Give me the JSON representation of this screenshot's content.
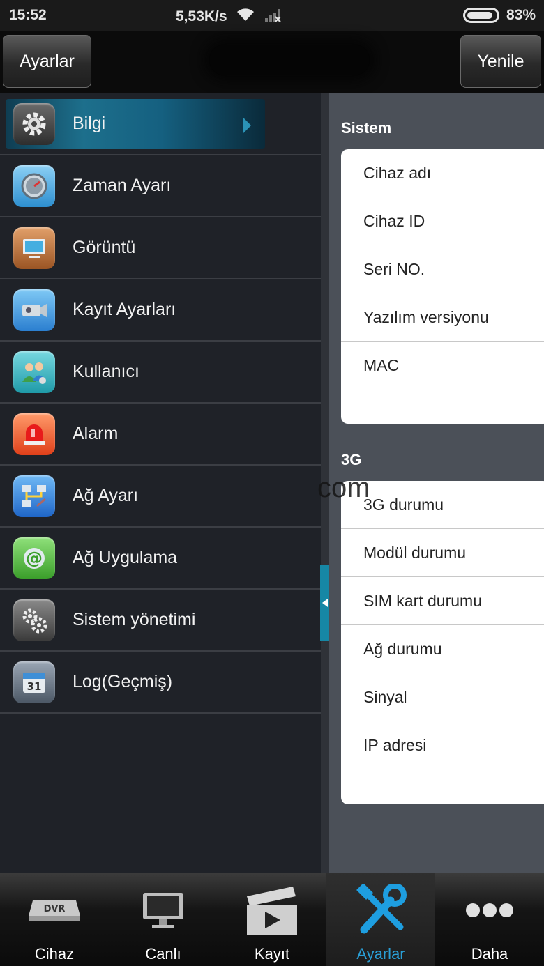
{
  "status_bar": {
    "time": "15:52",
    "network_speed": "5,53K/s",
    "battery": "83%",
    "icons": [
      "wifi-icon",
      "signal-icon",
      "battery-icon"
    ]
  },
  "header": {
    "left_button": "Ayarlar",
    "right_button": "Yenile"
  },
  "sidebar": {
    "items": [
      {
        "label": "Bilgi",
        "icon": "gear-icon",
        "active": true
      },
      {
        "label": "Zaman Ayarı",
        "icon": "clock-icon"
      },
      {
        "label": "Görüntü",
        "icon": "display-icon"
      },
      {
        "label": "Kayıt Ayarları",
        "icon": "camera-icon"
      },
      {
        "label": "Kullanıcı",
        "icon": "users-icon"
      },
      {
        "label": "Alarm",
        "icon": "alarm-icon"
      },
      {
        "label": "Ağ Ayarı",
        "icon": "network-icon"
      },
      {
        "label": "Ağ Uygulama",
        "icon": "at-icon"
      },
      {
        "label": "Sistem yönetimi",
        "icon": "gears-icon"
      },
      {
        "label": "Log(Geçmiş)",
        "icon": "calendar-icon"
      }
    ]
  },
  "content": {
    "sections": [
      {
        "title": "Sistem",
        "rows": [
          "Cihaz adı",
          "Cihaz ID",
          "Seri NO.",
          "Yazılım versiyonu",
          "MAC"
        ]
      },
      {
        "title": "3G",
        "rows": [
          "3G durumu",
          "Modül durumu",
          "SIM kart durumu",
          "Ağ durumu",
          "Sinyal",
          "IP adresi"
        ]
      }
    ],
    "watermark": "com"
  },
  "tabbar": {
    "tabs": [
      {
        "label": "Cihaz",
        "icon": "dvr-icon"
      },
      {
        "label": "Canlı",
        "icon": "monitor-icon"
      },
      {
        "label": "Kayıt",
        "icon": "clapper-icon"
      },
      {
        "label": "Ayarlar",
        "icon": "tools-icon",
        "active": true
      },
      {
        "label": "Daha",
        "icon": "more-icon"
      }
    ],
    "accent_color": "#2a9fd6"
  }
}
